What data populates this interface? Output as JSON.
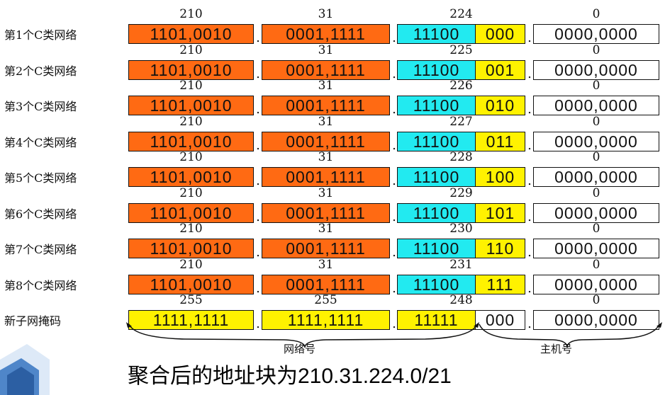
{
  "rows": [
    {
      "label": "第1个C类网络",
      "decimals": [
        "210",
        "31",
        "224",
        "0"
      ],
      "bits": [
        "1101,0010",
        "0001,1111",
        "11100",
        "000",
        "0000,0000"
      ],
      "style": "network"
    },
    {
      "label": "第2个C类网络",
      "decimals": [
        "210",
        "31",
        "225",
        "0"
      ],
      "bits": [
        "1101,0010",
        "0001,1111",
        "11100",
        "001",
        "0000,0000"
      ],
      "style": "network"
    },
    {
      "label": "第3个C类网络",
      "decimals": [
        "210",
        "31",
        "226",
        "0"
      ],
      "bits": [
        "1101,0010",
        "0001,1111",
        "11100",
        "010",
        "0000,0000"
      ],
      "style": "network"
    },
    {
      "label": "第4个C类网络",
      "decimals": [
        "210",
        "31",
        "227",
        "0"
      ],
      "bits": [
        "1101,0010",
        "0001,1111",
        "11100",
        "011",
        "0000,0000"
      ],
      "style": "network"
    },
    {
      "label": "第5个C类网络",
      "decimals": [
        "210",
        "31",
        "228",
        "0"
      ],
      "bits": [
        "1101,0010",
        "0001,1111",
        "11100",
        "100",
        "0000,0000"
      ],
      "style": "network"
    },
    {
      "label": "第6个C类网络",
      "decimals": [
        "210",
        "31",
        "229",
        "0"
      ],
      "bits": [
        "1101,0010",
        "0001,1111",
        "11100",
        "101",
        "0000,0000"
      ],
      "style": "network"
    },
    {
      "label": "第7个C类网络",
      "decimals": [
        "210",
        "31",
        "230",
        "0"
      ],
      "bits": [
        "1101,0010",
        "0001,1111",
        "11100",
        "110",
        "0000,0000"
      ],
      "style": "network"
    },
    {
      "label": "第8个C类网络",
      "decimals": [
        "210",
        "31",
        "231",
        "0"
      ],
      "bits": [
        "1101,0010",
        "0001,1111",
        "11100",
        "111",
        "0000,0000"
      ],
      "style": "network"
    },
    {
      "label": "新子网掩码",
      "decimals": [
        "255",
        "255",
        "248",
        "0"
      ],
      "bits": [
        "1111,1111",
        "1111,1111",
        "11111",
        "000",
        "0000,0000"
      ],
      "style": "mask"
    }
  ],
  "separator": ".",
  "brackets": {
    "network_label": "网络号",
    "host_label": "主机号"
  },
  "caption": "聚合后的地址块为210.31.224.0/21",
  "colors": {
    "octet": "#ff6a13",
    "prefix": "#22eaf0",
    "varying": "#fff200",
    "host": "#ffffff",
    "mask": "#fff200"
  }
}
